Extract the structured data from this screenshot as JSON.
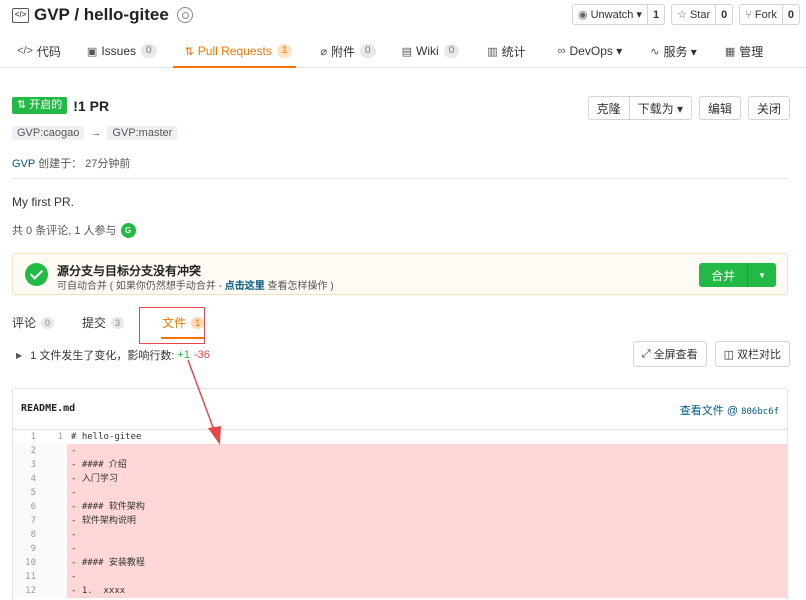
{
  "repo": {
    "title": "GVP / hello-gitee",
    "actions": [
      {
        "icon": "eye-icon",
        "label": "Unwatch ▾",
        "count": "1"
      },
      {
        "icon": "star-icon",
        "label": "Star",
        "count": "0"
      },
      {
        "icon": "fork-icon",
        "label": "Fork",
        "count": "0"
      }
    ]
  },
  "tabs": [
    {
      "label": "代码",
      "count": ""
    },
    {
      "label": "Issues",
      "count": "0"
    },
    {
      "label": "Pull Requests",
      "count": "1"
    },
    {
      "label": "附件",
      "count": "0"
    },
    {
      "label": "Wiki",
      "count": "0"
    },
    {
      "label": "统计",
      "count": ""
    },
    {
      "label": "DevOps ▾",
      "count": ""
    },
    {
      "label": "服务 ▾",
      "count": ""
    },
    {
      "label": "管理",
      "count": ""
    }
  ],
  "pr": {
    "state": "开启的",
    "title": "!1 PR",
    "buttons": {
      "clone": "克隆",
      "download": "下载为 ▾",
      "edit": "编辑",
      "close": "关闭"
    },
    "source_branch": "GVP:caogao",
    "target_branch": "GVP:master",
    "arrow": "→",
    "author": "GVP",
    "created_text": "创建于：  27分钟前",
    "body": "My first PR.",
    "participants_text": "共 0 条评论, 1 人参与",
    "avatar_letter": "G"
  },
  "merge": {
    "title": "源分支与目标分支没有冲突",
    "sub_before": "可自动合并 ( 如果你仍然想手动合并 - ",
    "sub_link": "点击这里",
    "sub_after": " 查看怎样操作 )",
    "button": "合并"
  },
  "subtabs": [
    {
      "label": "评论",
      "count": "0"
    },
    {
      "label": "提交",
      "count": "3"
    },
    {
      "label": "文件",
      "count": "1"
    }
  ],
  "stats": {
    "text": "1 文件发生了变化，影响行数:",
    "added": "+1",
    "deleted": "-36"
  },
  "view_buttons": {
    "fullscreen": "全屏查看",
    "split": "双栏对比"
  },
  "file": {
    "name": "README.md",
    "view_label": "查看文件 @ ",
    "sha": "806bc6f",
    "lines": [
      {
        "old": "1",
        "new": "1",
        "type": "ctx",
        "code": "# hello-gitee"
      },
      {
        "old": "2",
        "new": "",
        "type": "del",
        "code": "-"
      },
      {
        "old": "3",
        "new": "",
        "type": "del",
        "code": "- #### 介绍"
      },
      {
        "old": "4",
        "new": "",
        "type": "del",
        "code": "- 入门学习"
      },
      {
        "old": "5",
        "new": "",
        "type": "del",
        "code": "-"
      },
      {
        "old": "6",
        "new": "",
        "type": "del",
        "code": "- #### 软件架构"
      },
      {
        "old": "7",
        "new": "",
        "type": "del",
        "code": "- 软件架构说明"
      },
      {
        "old": "8",
        "new": "",
        "type": "del",
        "code": "-"
      },
      {
        "old": "9",
        "new": "",
        "type": "del",
        "code": "-"
      },
      {
        "old": "10",
        "new": "",
        "type": "del",
        "code": "- #### 安装教程"
      },
      {
        "old": "11",
        "new": "",
        "type": "del",
        "code": "-"
      },
      {
        "old": "12",
        "new": "",
        "type": "del",
        "code": "- 1.  xxxx"
      }
    ]
  },
  "colors": {
    "accent": "#fe7300",
    "green": "#21ba45",
    "link": "#005980",
    "annotation": "#e5474a"
  }
}
